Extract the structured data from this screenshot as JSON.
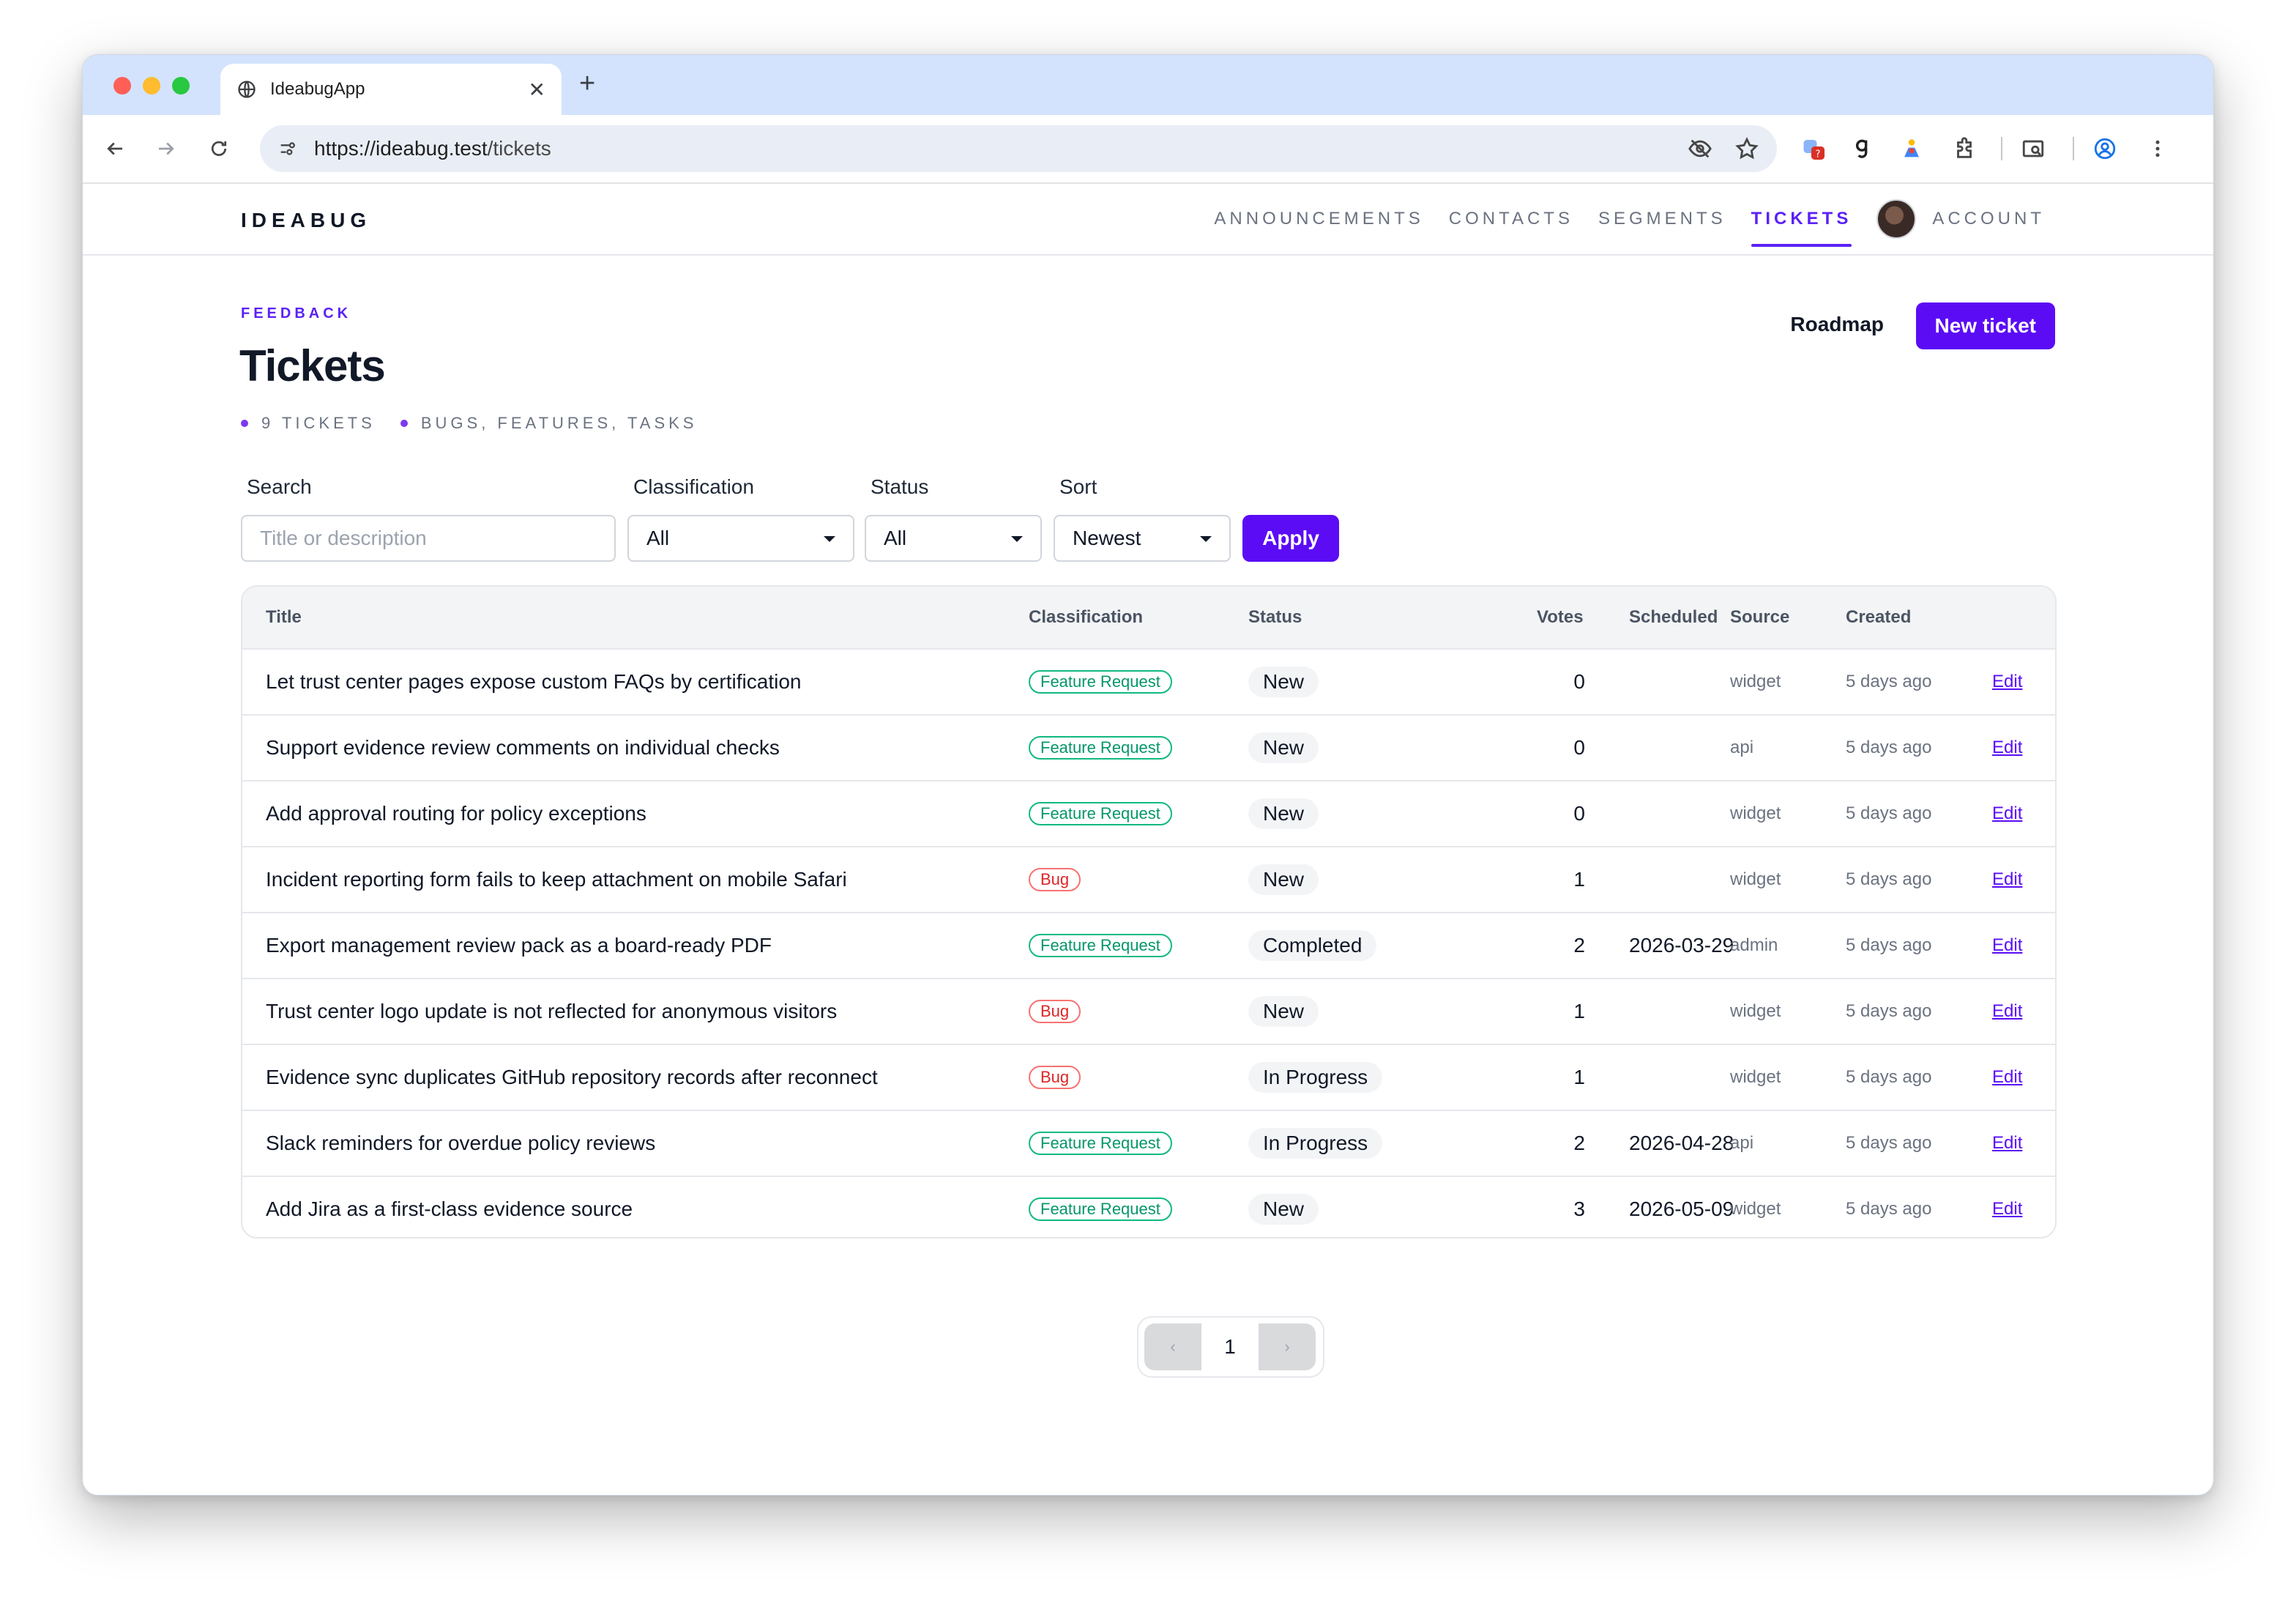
{
  "browser": {
    "tab_title": "IdeabugApp",
    "url_host": "https://ideabug.test",
    "url_path": "/tickets"
  },
  "app": {
    "logo": "IDEABUG",
    "nav": [
      "ANNOUNCEMENTS",
      "CONTACTS",
      "SEGMENTS",
      "TICKETS",
      "ACCOUNT"
    ],
    "active_nav": "TICKETS"
  },
  "page": {
    "eyebrow": "FEEDBACK",
    "title": "Tickets",
    "meta_count": "9 TICKETS",
    "meta_types": "BUGS, FEATURES, TASKS",
    "roadmap_label": "Roadmap",
    "new_ticket_label": "New ticket"
  },
  "filters": {
    "search_label": "Search",
    "search_placeholder": "Title or description",
    "classification_label": "Classification",
    "classification_value": "All",
    "status_label": "Status",
    "status_value": "All",
    "sort_label": "Sort",
    "sort_value": "Newest",
    "apply_label": "Apply"
  },
  "table": {
    "headers": {
      "title": "Title",
      "classification": "Classification",
      "status": "Status",
      "votes": "Votes",
      "scheduled": "Scheduled",
      "source": "Source",
      "created": "Created"
    },
    "edit_label": "Edit",
    "rows": [
      {
        "title": "Let trust center pages expose custom FAQs by certification",
        "classification": "Feature Request",
        "status": "New",
        "votes": "0",
        "scheduled": "",
        "source": "widget",
        "created": "5 days ago"
      },
      {
        "title": "Support evidence review comments on individual checks",
        "classification": "Feature Request",
        "status": "New",
        "votes": "0",
        "scheduled": "",
        "source": "api",
        "created": "5 days ago"
      },
      {
        "title": "Add approval routing for policy exceptions",
        "classification": "Feature Request",
        "status": "New",
        "votes": "0",
        "scheduled": "",
        "source": "widget",
        "created": "5 days ago"
      },
      {
        "title": "Incident reporting form fails to keep attachment on mobile Safari",
        "classification": "Bug",
        "status": "New",
        "votes": "1",
        "scheduled": "",
        "source": "widget",
        "created": "5 days ago"
      },
      {
        "title": "Export management review pack as a board-ready PDF",
        "classification": "Feature Request",
        "status": "Completed",
        "votes": "2",
        "scheduled": "2026-03-29",
        "source": "admin",
        "created": "5 days ago"
      },
      {
        "title": "Trust center logo update is not reflected for anonymous visitors",
        "classification": "Bug",
        "status": "New",
        "votes": "1",
        "scheduled": "",
        "source": "widget",
        "created": "5 days ago"
      },
      {
        "title": "Evidence sync duplicates GitHub repository records after reconnect",
        "classification": "Bug",
        "status": "In Progress",
        "votes": "1",
        "scheduled": "",
        "source": "widget",
        "created": "5 days ago"
      },
      {
        "title": "Slack reminders for overdue policy reviews",
        "classification": "Feature Request",
        "status": "In Progress",
        "votes": "2",
        "scheduled": "2026-04-28",
        "source": "api",
        "created": "5 days ago"
      },
      {
        "title": "Add Jira as a first-class evidence source",
        "classification": "Feature Request",
        "status": "New",
        "votes": "3",
        "scheduled": "2026-05-09",
        "source": "widget",
        "created": "5 days ago"
      }
    ]
  },
  "pagination": {
    "prev": "‹",
    "current": "1",
    "next": "›"
  },
  "colors": {
    "accent": "#5b0cf5",
    "feature_badge": "#10b981",
    "bug_badge": "#f87171"
  }
}
